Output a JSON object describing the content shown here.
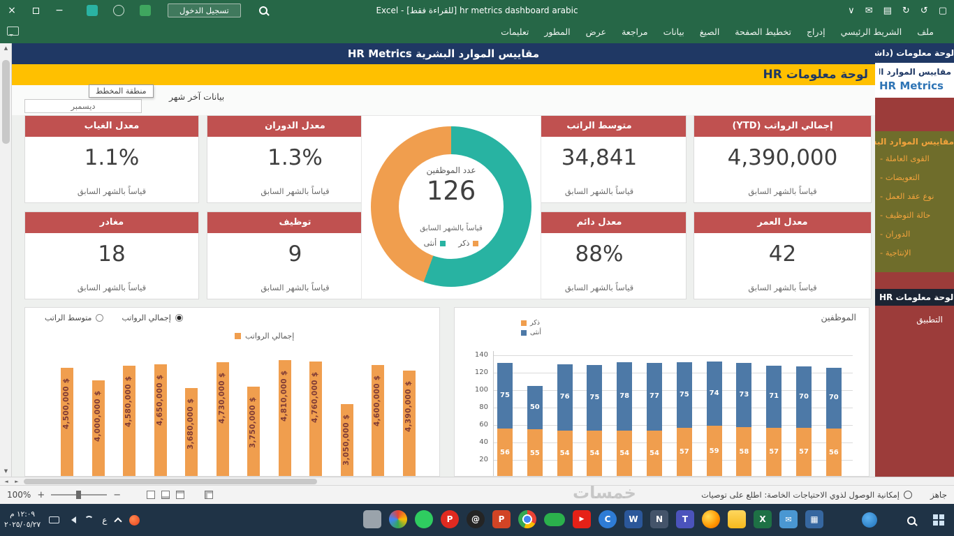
{
  "titlebar": {
    "title": "Excel - [للقراءة فقط] hr metrics dashboard arabic",
    "sign_in_label": "تسجيل الدخول",
    "qat_icons": [
      {
        "name": "customize-quick-access-icon",
        "glyph": "∨"
      },
      {
        "name": "email-icon",
        "glyph": "✉"
      },
      {
        "name": "print-icon",
        "glyph": "▤"
      },
      {
        "name": "redo-icon",
        "glyph": "↻"
      },
      {
        "name": "undo-icon",
        "glyph": "↺"
      },
      {
        "name": "save-icon",
        "glyph": "▢"
      }
    ]
  },
  "ribbon": {
    "tabs": [
      "ملف",
      "الشريط الرئيسي",
      "إدراج",
      "تخطيط الصفحة",
      "الصيغ",
      "بيانات",
      "مراجعة",
      "عرض",
      "المطور",
      "تعليمات"
    ]
  },
  "dashboard": {
    "header_title": "مقاييس الموارد البشرية HR Metrics",
    "banner_title": "لوحة معلومات HR",
    "last_month_label": "بيانات آخر شهر",
    "chart_area_tooltip": "منطقة المخطط",
    "month_selector": "ديسمبر",
    "kpis": [
      {
        "title": "إجمالي الرواتب (YTD)",
        "value": "4,390,000",
        "note": "قياساً بالشهر السابق"
      },
      {
        "title": "متوسط الراتب",
        "value": "34,841",
        "note": "قياساً بالشهر السابق"
      },
      {
        "title": "معدل الدوران",
        "value": "1.3%",
        "note": "قياساً بالشهر السابق"
      },
      {
        "title": "معدل الغياب",
        "value": "1.1%",
        "note": "قياساً بالشهر السابق"
      },
      {
        "title": "معدل العمر",
        "value": "42",
        "note": "قياساً بالشهر السابق"
      },
      {
        "title": "معدل دائم",
        "value": "88%",
        "note": "قياساً بالشهر السابق"
      },
      {
        "title": "توظيف",
        "value": "9",
        "note": "قياساً بالشهر السابق"
      },
      {
        "title": "مغادر",
        "value": "18",
        "note": "قياساً بالشهر السابق"
      }
    ]
  },
  "chart_data": [
    {
      "id": "total_salaries",
      "type": "bar",
      "legend": "إجمالي الرواتب",
      "options": [
        "متوسط الراتب",
        "إجمالي الرواتب"
      ],
      "selected_option": "إجمالي الرواتب",
      "color": "#F09E4E",
      "label_color": "#7F3B35",
      "values": [
        4500000,
        4000000,
        4580000,
        4650000,
        3680000,
        4730000,
        3750000,
        4810000,
        4760000,
        3050000,
        4600000,
        4390000
      ],
      "labels": [
        "4,500,000 $",
        "4,000,000 $",
        "4,580,000 $",
        "4,650,000 $",
        "3,680,000 $",
        "4,730,000 $",
        "3,750,000 $",
        "4,810,000 $",
        "4,760,000 $",
        "3,050,000 $",
        "4,600,000 $",
        "4,390,000 $"
      ],
      "ylim": [
        0,
        5000000
      ]
    },
    {
      "id": "employees",
      "type": "bar",
      "stacked": true,
      "title": "الموظفين",
      "series": [
        {
          "name": "ذكر",
          "color": "#F09E4E",
          "values": [
            56,
            55,
            54,
            54,
            54,
            54,
            57,
            59,
            58,
            57,
            57,
            56
          ]
        },
        {
          "name": "أنثى",
          "color": "#4D79A7",
          "values": [
            75,
            50,
            76,
            75,
            78,
            77,
            75,
            74,
            73,
            71,
            70,
            70
          ]
        }
      ],
      "ylim": [
        0,
        140
      ],
      "yticks": [
        140,
        120,
        100,
        80,
        60,
        40,
        20
      ],
      "grid": true,
      "legend_position": "top-left"
    },
    {
      "id": "employee_gender",
      "type": "pie",
      "title": "عدد الموظفين",
      "center_value": 126,
      "note": "قياساً بالشهر السابق",
      "slices": [
        {
          "label": "أنثى",
          "value": 70,
          "color": "#28B3A2"
        },
        {
          "label": "ذكر",
          "value": 56,
          "color": "#F09E4E"
        }
      ]
    }
  ],
  "sidebar": {
    "top_title": "لوحة معلومات (داشبورد)",
    "subtitle_ar": "مقاييس الموارد البشرية",
    "subtitle_en": "HR Metrics",
    "section_title": "مقاييس الموارد البشرية",
    "items": [
      "- القوى العاملة",
      "- التعويضات",
      "- نوع عقد العمل",
      "- حالة التوظيف",
      "- الدوران",
      "- الإنتاجية"
    ],
    "footer_title": "لوحة معلومات HR",
    "footer_item": "التطبيق"
  },
  "statusbar": {
    "ready_label": "جاهز",
    "accessibility_label": "إمكانية الوصول لذوي الاحتياجات الخاصة: اطلع على توصيات",
    "zoom_level": "100%"
  },
  "taskbar": {
    "time": "١٢:٠٩ م",
    "date": "٢٠٢٥/٠٥/٢٧",
    "language_indicator": "ع",
    "app_icons": [
      {
        "name": "printer-icon",
        "shape": "square",
        "bg": "#9AA3AB"
      },
      {
        "name": "photos-icon",
        "shape": "circle",
        "bg": "conic-gradient(#E84335,#FBBC04,#34A853,#4285F4,#E84335)"
      },
      {
        "name": "whatsapp-icon",
        "shape": "circle",
        "bg": "#2FCC60"
      },
      {
        "name": "pinterest-icon",
        "shape": "circle",
        "bg": "#E02A20",
        "glyph": "P"
      },
      {
        "name": "threads-icon",
        "shape": "circle",
        "bg": "#242424",
        "glyph": "@"
      },
      {
        "name": "powerpoint-icon",
        "shape": "square",
        "bg": "#D14425",
        "glyph": "P"
      },
      {
        "name": "chrome-icon",
        "shape": "circle",
        "bg": "radial-gradient(circle,#4285F4 0 5px,#fff 5px 7px,transparent 7px), conic-gradient(#EA4335 0 120deg,#FBBC04 120deg 200deg,#34A853 200deg 360deg)"
      },
      {
        "name": "green-oval-app-icon",
        "shape": "pill",
        "bg": "#2BB14C"
      },
      {
        "name": "youtube-icon",
        "shape": "square",
        "bg": "#E62117",
        "glyph": "▶",
        "fs": 9
      },
      {
        "name": "corel-app-icon",
        "shape": "circle",
        "bg": "#2E7CD6",
        "glyph": "C"
      },
      {
        "name": "word-icon",
        "shape": "square",
        "bg": "#2B579A",
        "glyph": "W"
      },
      {
        "name": "onenote-icon",
        "shape": "square",
        "bg": "#44546A",
        "glyph": "N"
      },
      {
        "name": "teams-icon",
        "shape": "square",
        "bg": "#4B53BC",
        "glyph": "T"
      },
      {
        "name": "firefox-icon",
        "shape": "circle",
        "bg": "radial-gradient(circle at 35% 35%,#FFDD55,#FF9500 60%,#E66000)"
      },
      {
        "name": "file-explorer-icon",
        "shape": "square",
        "bg": "linear-gradient(#FFD75E,#F5B91D)"
      },
      {
        "name": "excel-icon",
        "shape": "square",
        "bg": "#1E7145",
        "glyph": "X"
      },
      {
        "name": "mail-icon",
        "shape": "square",
        "bg": "#4A97D2",
        "glyph": "✉",
        "fs": 11
      },
      {
        "name": "calculator-icon",
        "shape": "square",
        "bg": "#3667A0",
        "glyph": "▦",
        "fs": 12
      }
    ]
  },
  "watermark": {
    "text": "خمسات"
  }
}
